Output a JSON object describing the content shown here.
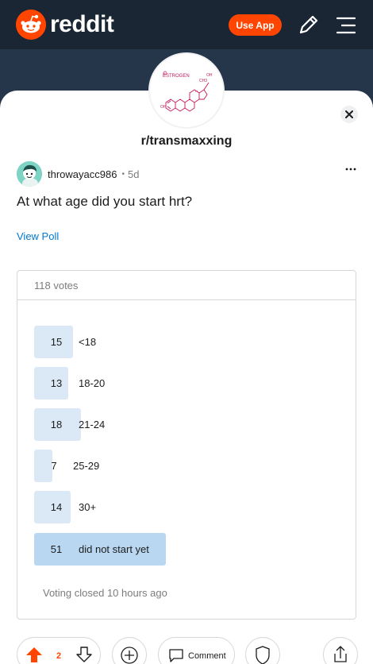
{
  "header": {
    "logo_text": "reddit",
    "use_app_label": "Use App"
  },
  "community": {
    "name": "r/transmaxxing",
    "icon_text": "ESTROGEN",
    "icon_oh_top": "OH",
    "icon_oh_bottom": "OH",
    "icon_ch3": "CH3",
    "icon_h": "H"
  },
  "post": {
    "username": "throwayacc986",
    "separator": "•",
    "age": "5d",
    "title": "At what age did you start hrt?",
    "view_poll": "View Poll"
  },
  "poll": {
    "total_votes": "118 votes",
    "options": [
      {
        "count": "15",
        "label": "<18",
        "votes": 15
      },
      {
        "count": "13",
        "label": "18-20",
        "votes": 13
      },
      {
        "count": "18",
        "label": "21-24",
        "votes": 18
      },
      {
        "count": "7",
        "label": "25-29",
        "votes": 7
      },
      {
        "count": "14",
        "label": "30+",
        "votes": 14
      },
      {
        "count": "51",
        "label": "did not start yet",
        "votes": 51
      }
    ],
    "status": "Voting closed 10 hours ago"
  },
  "actions": {
    "score": "2",
    "comment_label": "Comment"
  },
  "colors": {
    "brand": "#ff4500",
    "link": "#0079d3",
    "poll_bar": "#dbe9f6",
    "poll_winner": "#b9d7f1"
  }
}
